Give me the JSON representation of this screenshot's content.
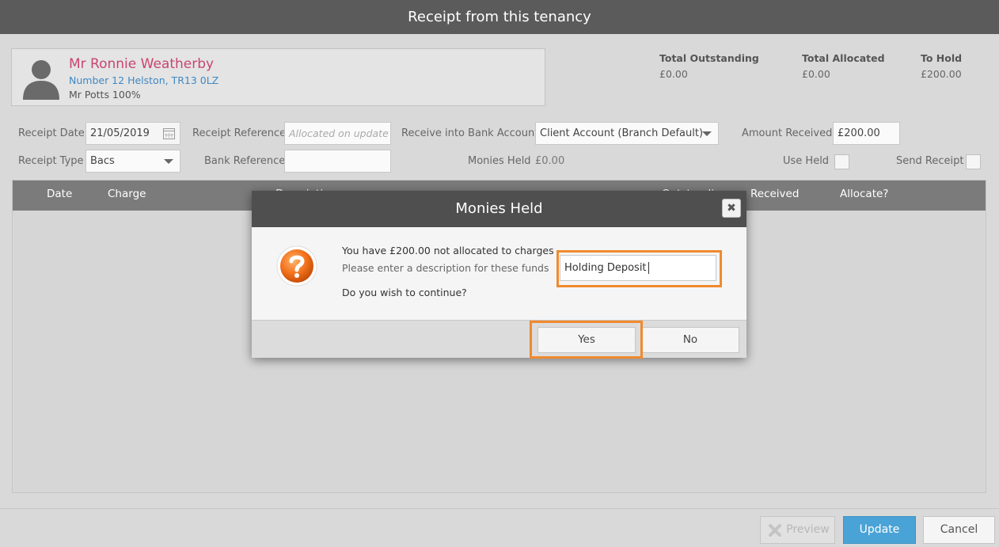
{
  "window": {
    "title": "Receipt from this tenancy"
  },
  "tenant": {
    "name": "Mr Ronnie Weatherby",
    "address": "Number 12 Helston, TR13 0LZ",
    "landlord": "Mr Potts 100%"
  },
  "totals": [
    {
      "label": "Total Outstanding",
      "value": "£0.00"
    },
    {
      "label": "Total Allocated",
      "value": "£0.00"
    },
    {
      "label": "To Hold",
      "value": "£200.00"
    }
  ],
  "form": {
    "receipt_date_label": "Receipt Date",
    "receipt_date_value": "21/05/2019",
    "receipt_reference_label": "Receipt Reference",
    "receipt_reference_placeholder": "Allocated on update",
    "bank_account_label": "Receive into Bank Account",
    "bank_account_value": "Client Account (Branch Default)",
    "amount_received_label": "Amount Received",
    "amount_received_value": "£200.00",
    "receipt_type_label": "Receipt Type",
    "receipt_type_value": "Bacs",
    "bank_reference_label": "Bank Reference",
    "bank_reference_value": "",
    "monies_held_label": "Monies Held",
    "monies_held_value": "£0.00",
    "use_held_label": "Use Held",
    "send_receipt_label": "Send Receipt"
  },
  "grid": {
    "columns": [
      "Date",
      "Charge",
      "Description",
      "Outstanding",
      "Received",
      "Allocate?"
    ]
  },
  "footer": {
    "preview": "Preview",
    "update": "Update",
    "cancel": "Cancel"
  },
  "modal": {
    "title": "Monies Held",
    "close": "✖",
    "line1": "You have £200.00 not allocated to charges",
    "line2": "Please enter a description for these funds",
    "line3": "Do you wish to continue?",
    "description_value": "Holding Deposit",
    "yes": "Yes",
    "no": "No"
  },
  "colors": {
    "accent": "#4aa3d6",
    "highlight": "#f08a2e",
    "tenant_name": "#c8466f",
    "address": "#3f88c4"
  }
}
